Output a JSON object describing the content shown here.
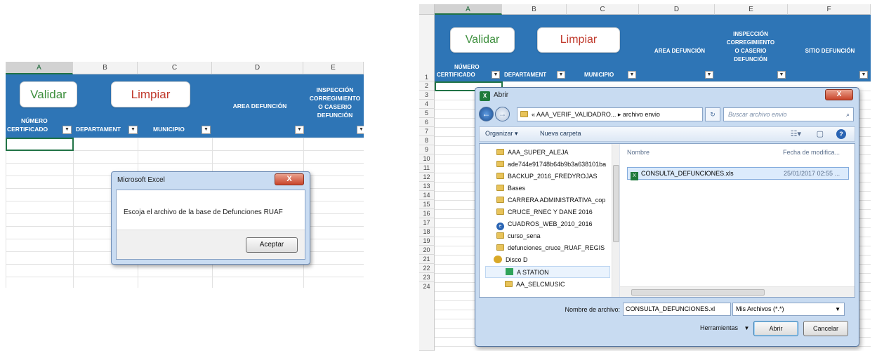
{
  "left": {
    "columns": [
      "A",
      "B",
      "C",
      "D",
      "E"
    ],
    "header": {
      "validar": "Validar",
      "limpiar": "Limpiar",
      "numero_line1": "NÚMERO",
      "numero_line2": "CERTIFICADO",
      "departamento": "DEPARTAMENT",
      "municipio": "MUNICIPIO",
      "area": "AREA DEFUNCIÓN",
      "inspeccion_1": "INSPECCIÓN",
      "inspeccion_2": "CORREGIMIENTO",
      "inspeccion_3": "O CASERIO",
      "inspeccion_4": "DEFUNCIÓN"
    },
    "msgbox": {
      "title": "Microsoft Excel",
      "close": "X",
      "text": "Escoja el archivo de la base de Defunciones RUAF",
      "ok": "Aceptar"
    }
  },
  "right": {
    "columns": [
      "A",
      "B",
      "C",
      "D",
      "E",
      "F"
    ],
    "rows": [
      "1",
      "2",
      "3",
      "4",
      "5",
      "6",
      "7",
      "8",
      "9",
      "10",
      "11",
      "12",
      "13",
      "14",
      "15",
      "16",
      "17",
      "18",
      "19",
      "20",
      "21",
      "22",
      "23",
      "24"
    ],
    "header": {
      "validar": "Validar",
      "limpiar": "Limpiar",
      "numero_line1": "NÚMERO",
      "numero_line2": "CERTIFICADO",
      "departamento": "DEPARTAMENT",
      "municipio": "MUNICIPIO",
      "area": "AREA DEFUNCIÓN",
      "inspeccion_1": "INSPECCIÓN",
      "inspeccion_2": "CORREGIMIENTO",
      "inspeccion_3": "O CASERIO",
      "inspeccion_4": "DEFUNCIÓN",
      "sitio": "SITIO DEFUNCIÓN"
    },
    "dialog": {
      "title": "Abrir",
      "close": "X",
      "breadcrumb": "« AAA_VERIF_VALIDADRO... ▸ archivo envio",
      "search_placeholder": "Buscar archivo envio",
      "organizar": "Organizar ▾",
      "nueva_carpeta": "Nueva carpeta",
      "tree": [
        "AAA_SUPER_ALEJA",
        "ade744e91748b64b9b3a638101ba",
        "BACKUP_2016_FREDYROJAS",
        "Bases",
        "CARRERA ADMINISTRATIVA_cop",
        "CRUCE_RNEC Y DANE 2016",
        "CUADROS_WEB_2010_2016",
        "curso_sena",
        "defunciones_cruce_RUAF_REGIS",
        "Disco D",
        "A STATION",
        "AA_SELCMUSIC"
      ],
      "col_nombre": "Nombre",
      "col_fecha": "Fecha de modifica...",
      "file_name": "CONSULTA_DEFUNCIONES.xls",
      "file_date": "25/01/2017 02:55 ...",
      "filename_label": "Nombre de archivo:",
      "filename_value": "CONSULTA_DEFUNCIONES.xl",
      "filetype": "Mis Archivos (*.*)",
      "herramientas": "Herramientas",
      "abrir": "Abrir",
      "cancelar": "Cancelar"
    }
  },
  "colors": {
    "header_blue": "#2e75b6",
    "validar_green": "#3d8f3d",
    "limpiar_red": "#c0392b",
    "excel_green": "#217346"
  }
}
